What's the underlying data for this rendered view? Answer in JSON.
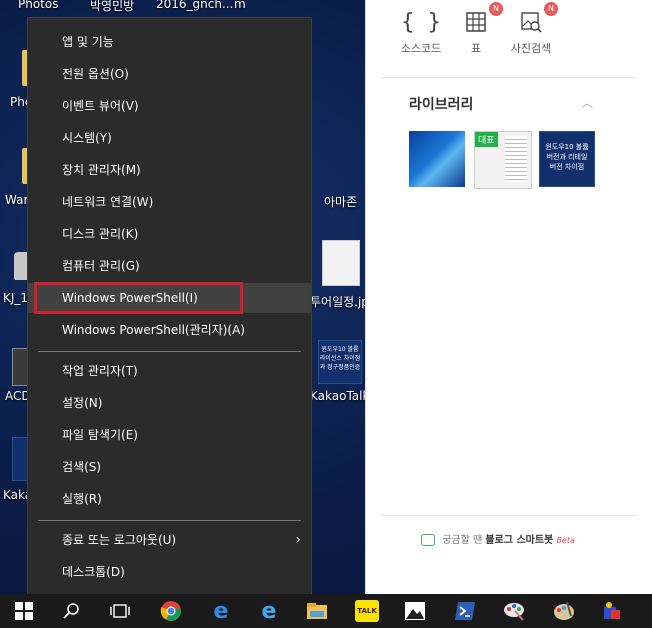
{
  "desktop": {
    "top_labels": [
      "Photos",
      "박영민방",
      "2016_gnch...",
      "m"
    ],
    "left_labels": [
      "Pho",
      "War",
      "KJ_1",
      "ACD",
      "Kaka"
    ],
    "right_labels": [
      "아마존",
      "투어일정.jpg",
      "KakaoTalk_..."
    ],
    "blue_thumb_text": "윈도우10 볼륨라이선스 차이점과 정구정품인증"
  },
  "context_menu": {
    "items": [
      {
        "label": "앱 및 기능"
      },
      {
        "label": "전원 옵션(O)"
      },
      {
        "label": "이벤트 뷰어(V)"
      },
      {
        "label": "시스템(Y)"
      },
      {
        "label": "장치 관리자(M)"
      },
      {
        "label": "네트워크 연결(W)"
      },
      {
        "label": "디스크 관리(K)"
      },
      {
        "label": "컴퓨터 관리(G)"
      },
      {
        "label": "Windows PowerShell(I)"
      },
      {
        "label": "Windows PowerShell(관리자)(A)"
      },
      {
        "label": "작업 관리자(T)"
      },
      {
        "label": "설정(N)"
      },
      {
        "label": "파일 탐색기(E)"
      },
      {
        "label": "검색(S)"
      },
      {
        "label": "실행(R)"
      },
      {
        "label": "종료 또는 로그아웃(U)"
      },
      {
        "label": "데스크톱(D)"
      }
    ],
    "highlighted": "Windows PowerShell(I)",
    "highlight_color": "#d41f2b"
  },
  "panel": {
    "tools": [
      {
        "label": "소스코드",
        "icon": "braces-icon"
      },
      {
        "label": "표",
        "icon": "table-icon",
        "badge": "N"
      },
      {
        "label": "사진검색",
        "icon": "image-search-icon",
        "badge": "N"
      }
    ],
    "library_title": "라이브러리",
    "library_thumbs": [
      {
        "type": "windows-wallpaper"
      },
      {
        "type": "document",
        "tag": "대표"
      },
      {
        "type": "title-card",
        "text": "윈도우10 볼륨버전과 리테일버전 차이점"
      }
    ],
    "bot_pre": "궁금할 땐",
    "bot_bold": "블로그 스마트봇",
    "bot_beta": "Beta"
  },
  "taskbar": {
    "icons": [
      "start-icon",
      "search-icon",
      "task-view-icon",
      "chrome-icon",
      "edge-icon",
      "ie-icon",
      "file-explorer-icon",
      "kakaotalk-icon",
      "photos-icon",
      "powershell-icon",
      "paint-icon",
      "paint-palette-icon",
      "app-icon"
    ],
    "kakao_label": "TALK"
  }
}
